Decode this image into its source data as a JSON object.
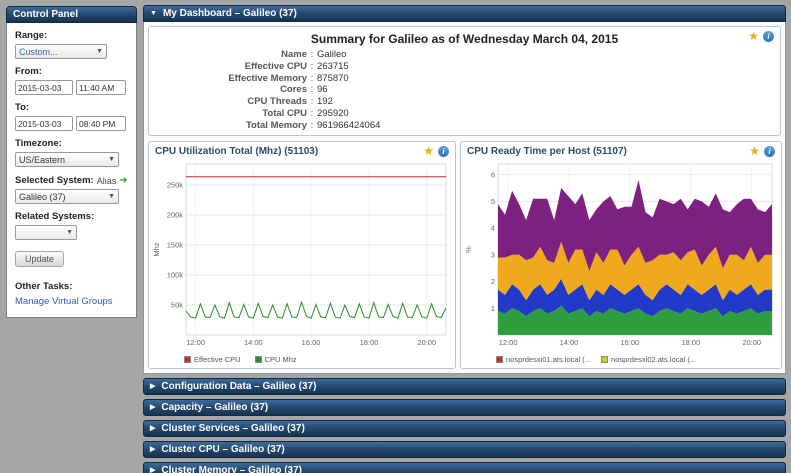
{
  "icons": {
    "star": "★",
    "info": "i",
    "expanded_arrow": "▼",
    "collapsed_arrow": "▶",
    "dropdown_arrow": "▼",
    "alias_arrow": "➜"
  },
  "control_panel": {
    "title": "Control Panel",
    "range_label": "Range:",
    "range_value": "Custom...",
    "from_label": "From:",
    "from_date": "2015-03-03",
    "from_time": "11:40 AM",
    "to_label": "To:",
    "to_date": "2015-03-03",
    "to_time": "08:40 PM",
    "timezone_label": "Timezone:",
    "timezone_value": "US/Eastern",
    "selected_system_label": "Selected System:",
    "alias_label": "Alias",
    "selected_system_value": "Galileo (37)",
    "related_systems_label": "Related Systems:",
    "related_systems_value": "",
    "update_button": "Update",
    "other_tasks_label": "Other Tasks:",
    "manage_virtual_groups_link": "Manage Virtual Groups"
  },
  "panels": {
    "dashboard_title": "My Dashboard – Galileo (37)",
    "collapsed": [
      "Configuration Data – Galileo (37)",
      "Capacity – Galileo (37)",
      "Cluster Services – Galileo (37)",
      "Cluster CPU – Galileo (37)",
      "Cluster Memory – Galileo (37)"
    ]
  },
  "summary": {
    "title": "Summary for Galileo as of Wednesday March 04, 2015",
    "colon": ":",
    "rows": [
      {
        "label": "Name",
        "value": "Galileo"
      },
      {
        "label": "Effective CPU",
        "value": "263715"
      },
      {
        "label": "Effective Memory",
        "value": "875870"
      },
      {
        "label": "Cores",
        "value": "96"
      },
      {
        "label": "CPU Threads",
        "value": "192"
      },
      {
        "label": "Total CPU",
        "value": "295920"
      },
      {
        "label": "Total Memory",
        "value": "961966424064"
      }
    ]
  },
  "chart_data": [
    {
      "type": "line",
      "title": "CPU Utilization Total (Mhz) (51103)",
      "ylabel": "Mhz",
      "ylim": [
        0,
        285000
      ],
      "y_ticks": [
        50000,
        100000,
        150000,
        200000,
        250000
      ],
      "y_tick_labels": [
        "50k",
        "100k",
        "150k",
        "200k",
        "250k"
      ],
      "x_ticks": [
        "12:00",
        "14:00",
        "16:00",
        "18:00",
        "20:00"
      ],
      "x_tick_pos": [
        0.037,
        0.259,
        0.481,
        0.704,
        0.926
      ],
      "grid": true,
      "legend_position": "bottom",
      "series": [
        {
          "name": "Effective CPU",
          "color": "#cc2a2a",
          "values": [
            263715,
            263715
          ]
        },
        {
          "name": "CPU Mhz",
          "color": "#2e8b2e",
          "values": [
            40000,
            30000,
            28000,
            52000,
            30000,
            29000,
            50000,
            31000,
            28000,
            54000,
            30000,
            29000,
            51000,
            30000,
            28000,
            53000,
            31000,
            29000,
            50000,
            30000,
            28000,
            52000,
            30000,
            29000,
            55000,
            31000,
            28000,
            51000,
            30000,
            29000,
            53000,
            30000,
            28000,
            50000,
            31000,
            29000,
            52000,
            30000,
            28000,
            54000,
            30000,
            29000,
            51000,
            31000,
            28000,
            53000,
            30000,
            29000,
            50000,
            30000,
            28000,
            52000,
            31000,
            29000,
            45000
          ]
        }
      ]
    },
    {
      "type": "stacked_area",
      "title": "CPU Ready Time per Host (51107)",
      "ylabel": "%",
      "ylim": [
        0,
        6.4
      ],
      "y_ticks": [
        1,
        2,
        3,
        4,
        5,
        6
      ],
      "x_ticks": [
        "12:00",
        "14:00",
        "16:00",
        "18:00",
        "20:00"
      ],
      "x_tick_pos": [
        0.037,
        0.259,
        0.481,
        0.704,
        0.926
      ],
      "grid": true,
      "legend_position": "bottom",
      "series": [
        {
          "color": "#2e9e3f",
          "values": [
            0.9,
            0.8,
            1.0,
            0.9,
            0.7,
            0.9,
            1.0,
            0.8,
            0.9,
            1.1,
            0.8,
            0.9,
            1.0,
            0.7,
            0.9,
            0.8,
            1.0,
            0.9,
            0.8,
            0.9,
            1.0,
            0.8,
            0.7,
            0.9,
            1.0,
            0.9,
            0.8,
            1.0,
            0.9,
            0.8,
            0.9,
            1.0,
            0.7,
            0.9,
            0.8,
            0.9,
            1.0,
            0.8,
            0.9,
            0.9
          ]
        },
        {
          "color": "#2339c8",
          "values": [
            0.8,
            0.7,
            0.9,
            0.8,
            0.6,
            0.8,
            0.9,
            0.7,
            0.8,
            1.0,
            0.7,
            0.8,
            0.9,
            0.6,
            0.8,
            0.7,
            0.9,
            0.8,
            0.7,
            0.8,
            0.9,
            0.7,
            0.6,
            0.8,
            0.9,
            0.8,
            0.7,
            0.9,
            0.8,
            0.7,
            0.8,
            0.9,
            0.6,
            0.8,
            0.7,
            0.8,
            0.9,
            0.7,
            0.8,
            0.8
          ]
        },
        {
          "color": "#f0a81f",
          "values": [
            1.2,
            1.4,
            1.1,
            1.3,
            1.5,
            1.2,
            1.4,
            1.3,
            1.0,
            1.4,
            1.2,
            1.5,
            1.3,
            1.1,
            1.4,
            1.2,
            1.3,
            1.5,
            1.1,
            1.3,
            1.4,
            1.2,
            1.5,
            1.3,
            1.1,
            1.4,
            1.3,
            1.2,
            1.5,
            1.1,
            1.3,
            1.4,
            1.2,
            1.3,
            1.5,
            1.1,
            1.4,
            1.2,
            1.3,
            1.3
          ]
        },
        {
          "color": "#7d2181",
          "values": [
            2.0,
            1.6,
            2.4,
            1.9,
            1.5,
            2.2,
            1.8,
            2.3,
            1.6,
            2.0,
            2.5,
            1.7,
            2.1,
            1.9,
            1.6,
            2.3,
            2.0,
            1.5,
            2.2,
            1.8,
            2.5,
            1.9,
            1.6,
            2.1,
            2.0,
            1.8,
            2.3,
            1.6,
            1.9,
            2.4,
            1.8,
            2.0,
            2.2,
            1.6,
            1.9,
            2.3,
            1.8,
            2.0,
            1.6,
            1.9
          ]
        }
      ],
      "legend": [
        {
          "label": "nosprdesxi01.ats.local (...",
          "color": "#cc2a2a"
        },
        {
          "label": "nosprdesxi02.ats.local (...",
          "color": "#c8cc33"
        }
      ]
    }
  ]
}
